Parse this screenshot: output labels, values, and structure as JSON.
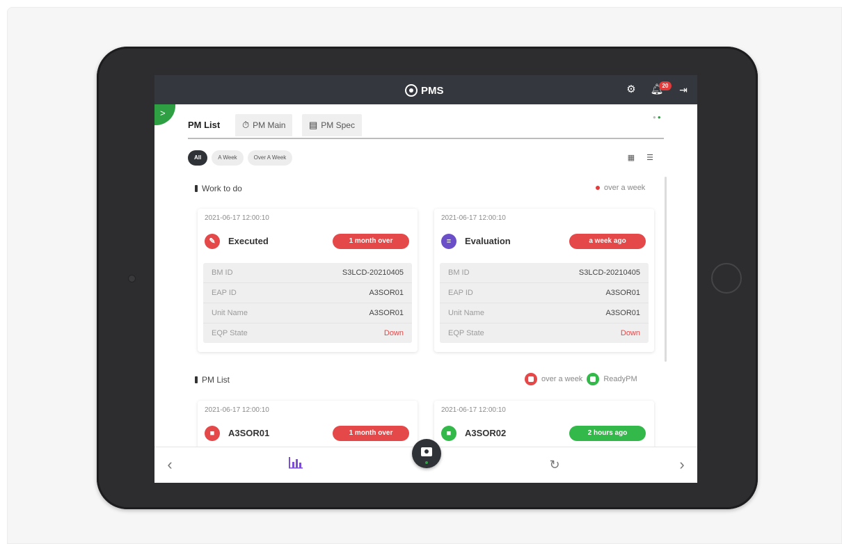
{
  "app": {
    "title": "PMS",
    "notification_count": "20"
  },
  "icons": {
    "settings": "gear-icon",
    "notifications": "bell-icon",
    "logout": "logout-icon",
    "sidebar_toggle": "chevron-right-icon"
  },
  "tabs": [
    {
      "label": "PM List",
      "icon": "",
      "active": true
    },
    {
      "label": "PM Main",
      "icon": "stopwatch-icon",
      "active": false
    },
    {
      "label": "PM Spec",
      "icon": "clipboard-icon",
      "active": false
    }
  ],
  "filters": [
    {
      "label": "All",
      "active": true
    },
    {
      "label": "A Week",
      "active": false
    },
    {
      "label": "Over A Week",
      "active": false
    }
  ],
  "sections": {
    "work": {
      "title": "Work to do",
      "legend": "over a week"
    },
    "pm_list": {
      "title": "PM List",
      "legend_over": "over a week",
      "legend_ready": "ReadyPM"
    }
  },
  "work_cards": [
    {
      "timestamp": "2021-06-17 12:00:10",
      "status": "Executed",
      "badge": "1 month over",
      "badge_color": "#e54848",
      "icon_color": "#e54848",
      "rows": [
        {
          "key": "BM ID",
          "value": "S3LCD-20210405"
        },
        {
          "key": "EAP ID",
          "value": "A3SOR01"
        },
        {
          "key": "Unit Name",
          "value": "A3SOR01"
        },
        {
          "key": "EQP State",
          "value": "Down"
        }
      ]
    },
    {
      "timestamp": "2021-06-17 12:00:10",
      "status": "Evaluation",
      "badge": "a week ago",
      "badge_color": "#e54848",
      "icon_color": "#6a4fc8",
      "rows": [
        {
          "key": "BM ID",
          "value": "S3LCD-20210405"
        },
        {
          "key": "EAP ID",
          "value": "A3SOR01"
        },
        {
          "key": "Unit Name",
          "value": "A3SOR01"
        },
        {
          "key": "EQP State",
          "value": "Down"
        }
      ]
    }
  ],
  "pm_cards": [
    {
      "timestamp": "2021-06-17 12:00:10",
      "name": "A3SOR01",
      "badge": "1 month over",
      "badge_color": "#e54848",
      "icon_color": "#e54848"
    },
    {
      "timestamp": "2021-06-17 12:00:10",
      "name": "A3SOR02",
      "badge": "2 hours ago",
      "badge_color": "#33b94a",
      "icon_color": "#33b94a"
    }
  ],
  "colors": {
    "accent_green": "#2ea043",
    "alert_red": "#e54848",
    "topbar": "#34373d"
  }
}
